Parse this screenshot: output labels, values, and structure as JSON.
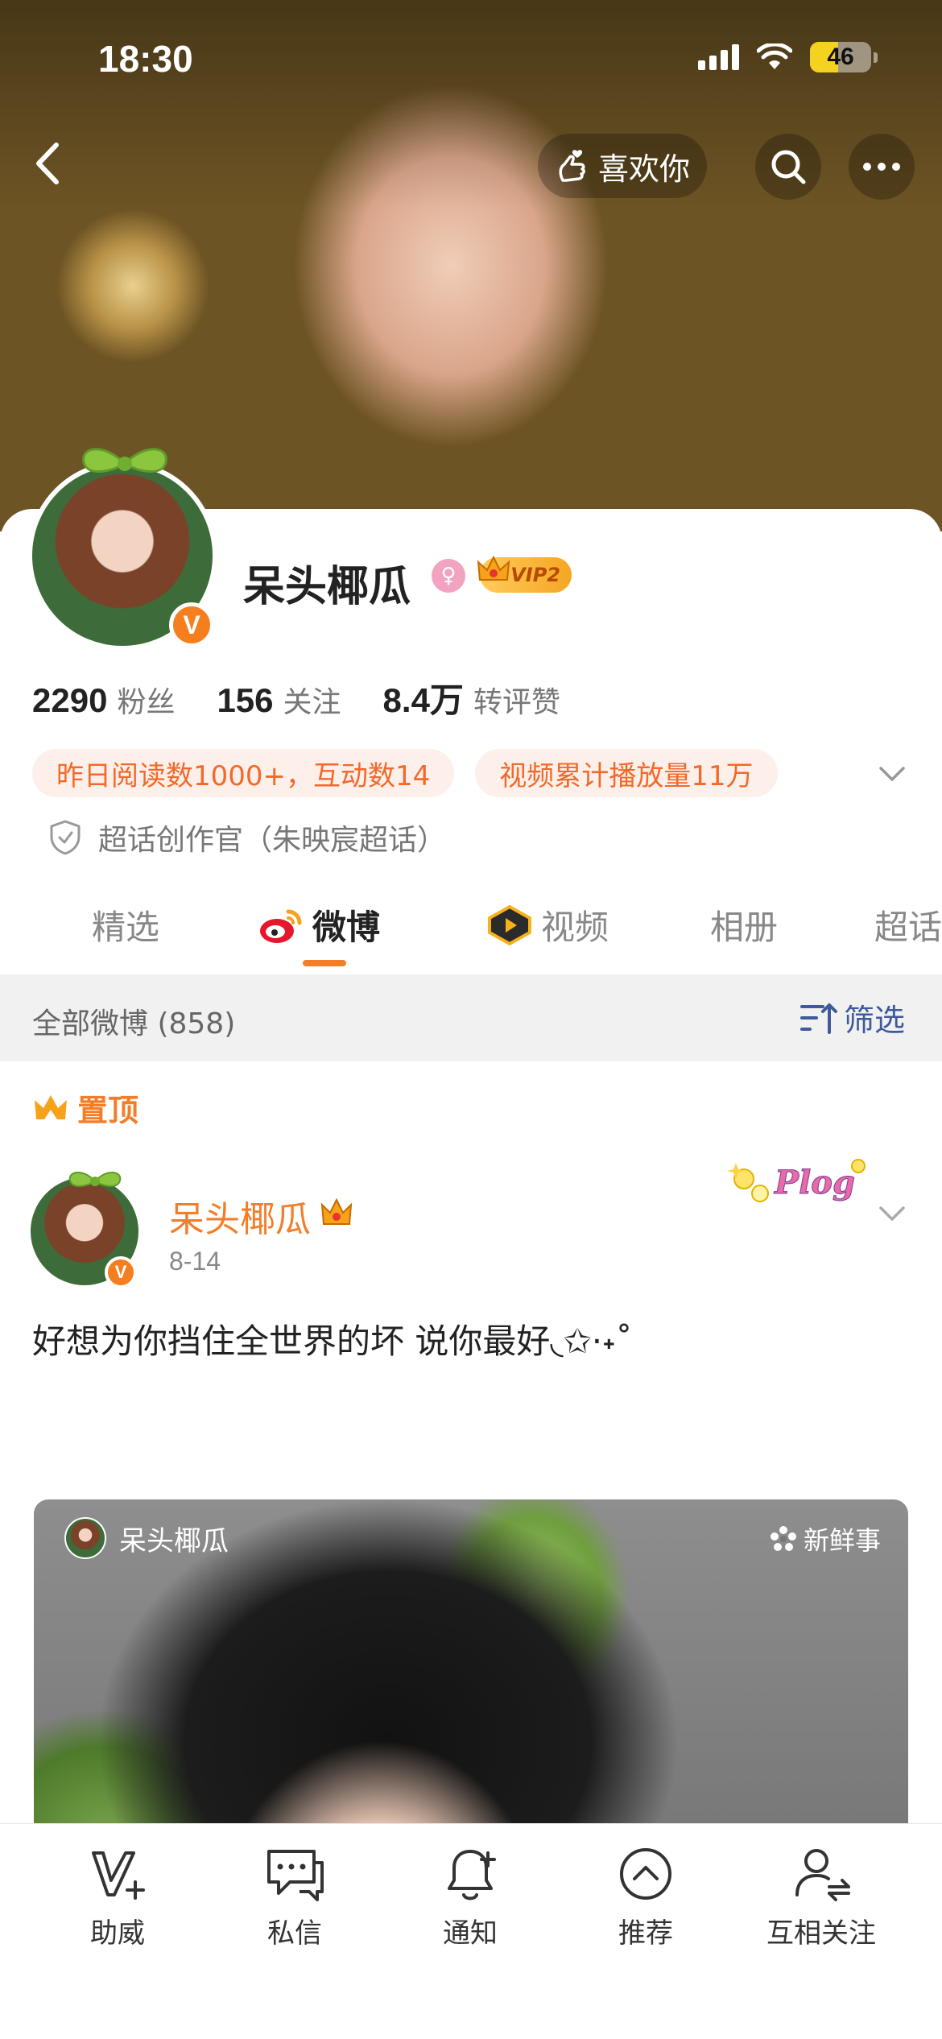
{
  "status_bar": {
    "time": "18:30",
    "battery": "46",
    "battery_level_percent": 46
  },
  "header": {
    "like_button_label": "喜欢你"
  },
  "profile": {
    "name": "呆头椰瓜",
    "vip_label": "VIP2",
    "verified_mark": "V",
    "stats": [
      {
        "value": "2290",
        "label": "粉丝"
      },
      {
        "value": "156",
        "label": "关注"
      },
      {
        "value": "8.4万",
        "label": "转评赞"
      }
    ],
    "tags": [
      "昨日阅读数1000+，互动数14",
      "视频累计播放量11万"
    ],
    "super_chat": "超话创作官（朱映宸超话）"
  },
  "tabs": [
    {
      "label": "精选",
      "active": false
    },
    {
      "label": "微博",
      "active": true
    },
    {
      "label": "视频",
      "active": false
    },
    {
      "label": "相册",
      "active": false
    },
    {
      "label": "超话",
      "active": false
    }
  ],
  "filter": {
    "count_label": "全部微博 (858)",
    "button_label": "筛选"
  },
  "post": {
    "pinned_label": "置顶",
    "author": "呆头椰瓜",
    "verified_mark": "V",
    "date": "8-14",
    "text": "好想为你挡住全世界的坏 说你最好◟✩·˖˚",
    "sticker_text": "Plog",
    "image_author": "呆头椰瓜",
    "image_badge": "新鲜事"
  },
  "bottom_nav": [
    {
      "label": "助威",
      "icon": "v-plus-icon"
    },
    {
      "label": "私信",
      "icon": "chat-icon"
    },
    {
      "label": "通知",
      "icon": "bell-plus-icon"
    },
    {
      "label": "推荐",
      "icon": "chevron-up-circle-icon"
    },
    {
      "label": "互相关注",
      "icon": "mutual-follow-icon"
    }
  ],
  "colors": {
    "accent": "#f27e2a",
    "link": "#3f5a9a",
    "tag_bg": "#fdf0ea"
  }
}
